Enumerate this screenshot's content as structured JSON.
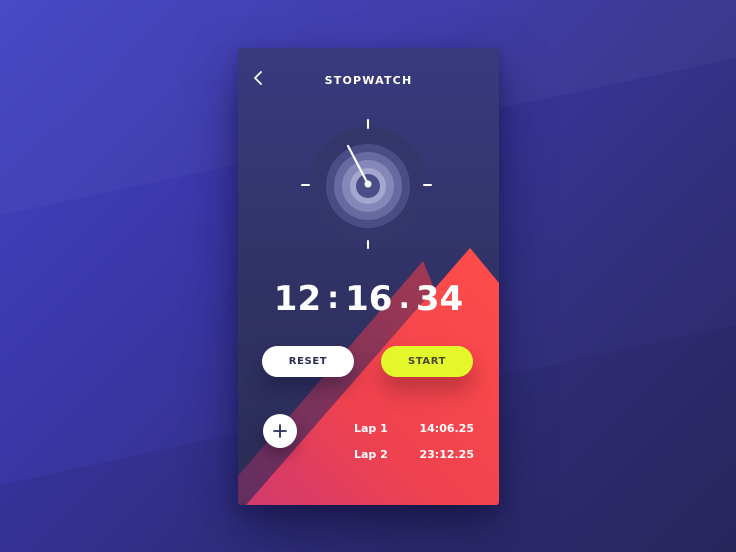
{
  "app": {
    "title": "STOPWATCH"
  },
  "timer": {
    "hours": "12",
    "minutes": "16",
    "seconds": "34",
    "separator_1": ":",
    "separator_2": "."
  },
  "controls": {
    "reset_label": "RESET",
    "start_label": "START"
  },
  "laps": [
    {
      "label": "Lap 1",
      "time": "14:06.25"
    },
    {
      "label": "Lap 2",
      "time": "23:12.25"
    }
  ],
  "icons": {
    "back": "chevron-left-icon",
    "add": "plus-icon",
    "dial": "stopwatch-dial-icon"
  },
  "colors": {
    "background": "#3a37a8",
    "card": "#333470",
    "accent_red": "#ff4b4b",
    "accent_pink": "#d23c6e",
    "start_button": "#e3f72a",
    "reset_button": "#ffffff",
    "text": "#ffffff"
  }
}
